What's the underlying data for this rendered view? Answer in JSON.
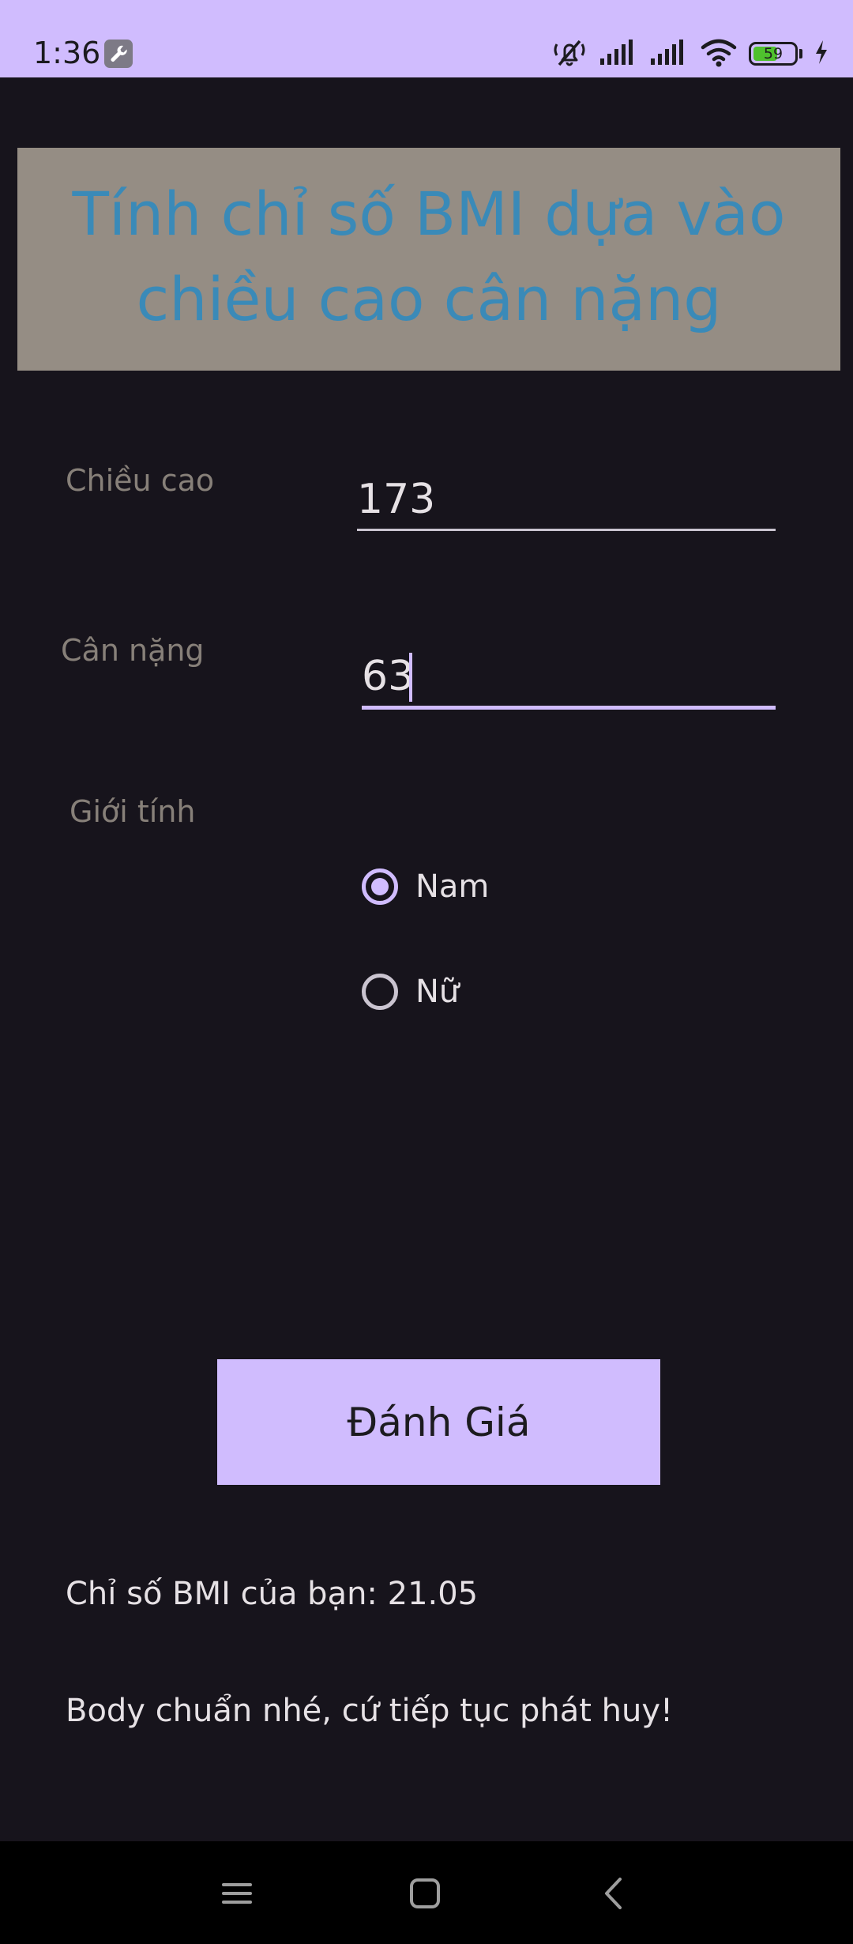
{
  "status_bar": {
    "time": "1:36",
    "battery_level": "59",
    "battery_fraction": 0.59,
    "icons": [
      "wrench-icon",
      "mute-icon",
      "signal-icon",
      "signal-icon",
      "wifi-icon",
      "battery-icon",
      "charging-icon"
    ]
  },
  "header": {
    "title": "Tính chỉ số BMI dựa vào chiều cao cân nặng"
  },
  "form": {
    "height_label": "Chiều cao",
    "height_value": "173",
    "weight_label": "Cân nặng",
    "weight_value": "63",
    "gender_label": "Giới tính",
    "gender_options": [
      {
        "label": "Nam",
        "checked": true
      },
      {
        "label": "Nữ",
        "checked": false
      }
    ]
  },
  "actions": {
    "evaluate_label": "Đánh Giá"
  },
  "result": {
    "bmi_text": "Chỉ số BMI của bạn: 21.05",
    "message": "Body chuẩn nhé, cứ tiếp tục phát huy!"
  },
  "nav": {
    "icons": [
      "menu-icon",
      "home-icon",
      "back-icon"
    ]
  },
  "colors": {
    "accent": "#d0bcfe",
    "background": "#17141c",
    "banner": "#958d84",
    "title": "#3a8ab8",
    "label": "#878079"
  }
}
